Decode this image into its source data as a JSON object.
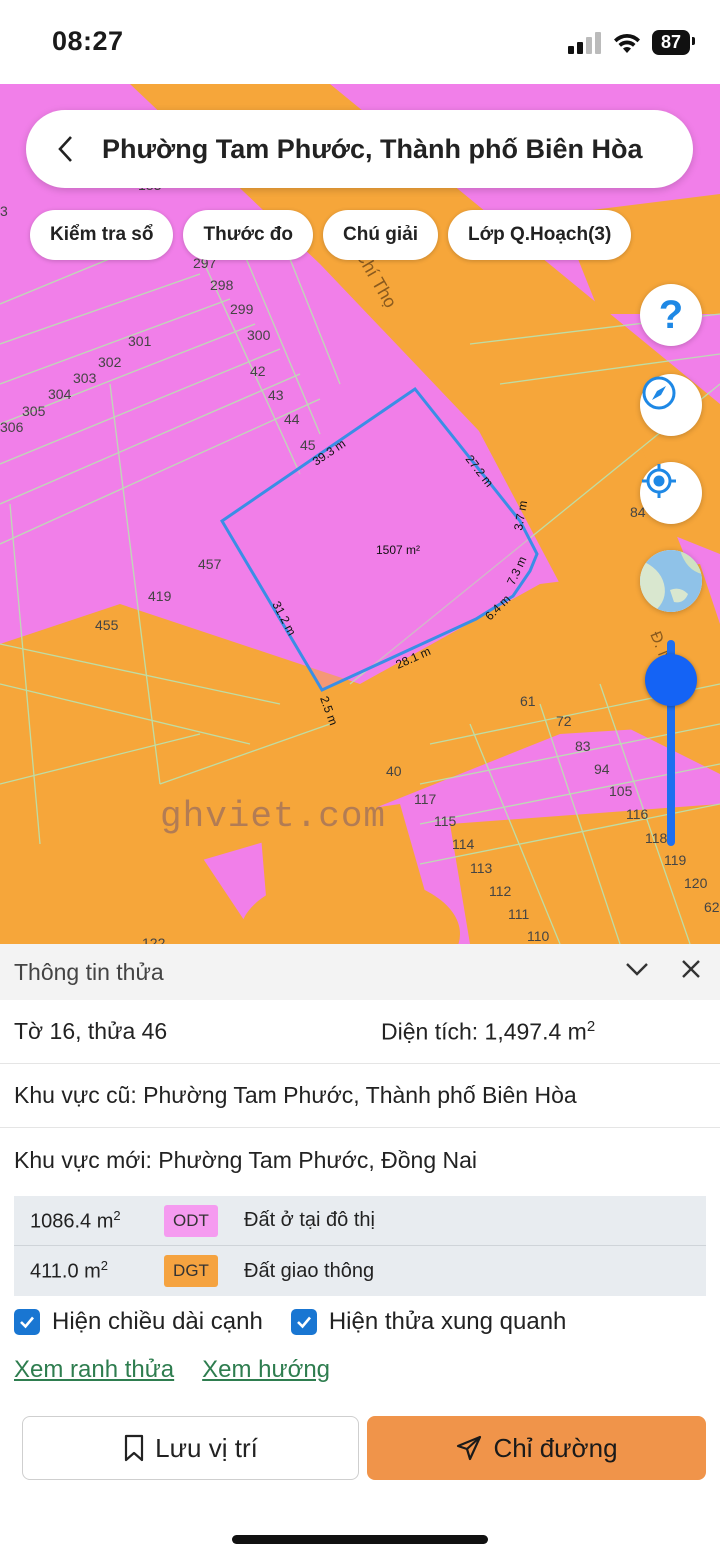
{
  "status_bar": {
    "time": "08:27",
    "battery": "87"
  },
  "search": {
    "title": "Phường Tam Phước, Thành phố Biên Hòa"
  },
  "chips": [
    "Kiểm tra sổ",
    "Thước đo",
    "Chú giải",
    "Lớp Q.Hoạch(3)"
  ],
  "controls": {
    "help_label": "?"
  },
  "map": {
    "watermark": "ghviet.com",
    "street_label": "Chí Thọ",
    "street_label_2": "Đ. N",
    "parcel_area": "1507 m²",
    "edges": [
      "39.3 m",
      "27.2 m",
      "3.7 m",
      "7.3 m",
      "6.4 m",
      "28.1 m",
      "2.5 m",
      "31.2 m"
    ],
    "lot_numbers": {
      "n183": "183",
      "n3": "3",
      "n297": "297",
      "n298": "298",
      "n299": "299",
      "n300": "300",
      "n301": "301",
      "n302": "302",
      "n303": "303",
      "n304": "304",
      "n305": "305",
      "n306": "306",
      "n42": "42",
      "n43": "43",
      "n44": "44",
      "n45": "45",
      "n457": "457",
      "n419": "419",
      "n455": "455",
      "n84": "84",
      "n61": "61",
      "n72": "72",
      "n83": "83",
      "n94": "94",
      "n105": "105",
      "n116": "116",
      "n118": "118",
      "n119": "119",
      "n120": "120",
      "n62": "62",
      "n40": "40",
      "n117": "117",
      "n115": "115",
      "n114": "114",
      "n113": "113",
      "n112": "112",
      "n111": "111",
      "n110": "110",
      "n122": "122"
    },
    "colors": {
      "residential": "#f17fe9",
      "road": "#f6a63a",
      "boundary": "#3a8ee6"
    }
  },
  "panel": {
    "title": "Thông tin thửa",
    "sheet_parcel": "Tờ 16, thửa 46",
    "area_label": "Diện tích: 1,497.4 m",
    "area_sup": "2",
    "old_area": "Khu vực cũ: Phường Tam Phước, Thành phố Biên Hòa",
    "new_area": "Khu vực mới: Phường Tam Phước, Đồng Nai",
    "land_uses": [
      {
        "area": "1086.4 m",
        "sup": "2",
        "code": "ODT",
        "desc": "Đất ở tại đô thị",
        "color": "#f59bf0"
      },
      {
        "area": "411.0 m",
        "sup": "2",
        "code": "DGT",
        "desc": "Đất giao thông",
        "color": "#f5a340"
      }
    ],
    "checks": {
      "edge_length": "Hiện chiều dài cạnh",
      "neighbors": "Hiện thửa xung quanh"
    },
    "links": {
      "boundary": "Xem ranh thửa",
      "direction": "Xem hướng"
    },
    "buttons": {
      "save": "Lưu vị trí",
      "route": "Chỉ đường"
    }
  }
}
